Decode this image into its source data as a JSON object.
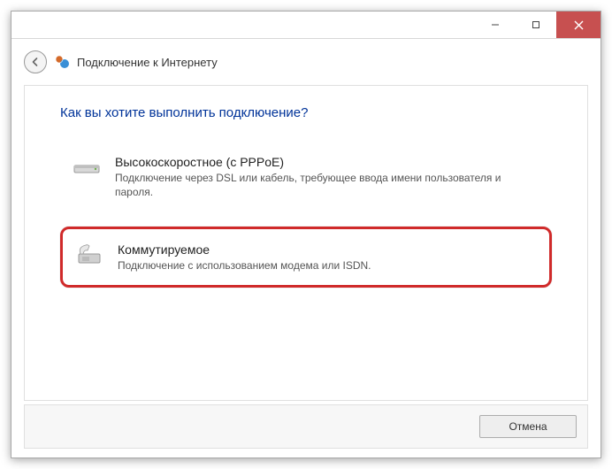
{
  "window": {
    "title": "Подключение к Интернету"
  },
  "main": {
    "heading": "Как вы хотите выполнить подключение?",
    "options": [
      {
        "title": "Высокоскоростное (с PPPoE)",
        "desc": "Подключение через DSL или кабель, требующее ввода имени пользователя и пароля."
      },
      {
        "title": "Коммутируемое",
        "desc": "Подключение с использованием модема или ISDN."
      }
    ]
  },
  "footer": {
    "cancel": "Отмена"
  }
}
